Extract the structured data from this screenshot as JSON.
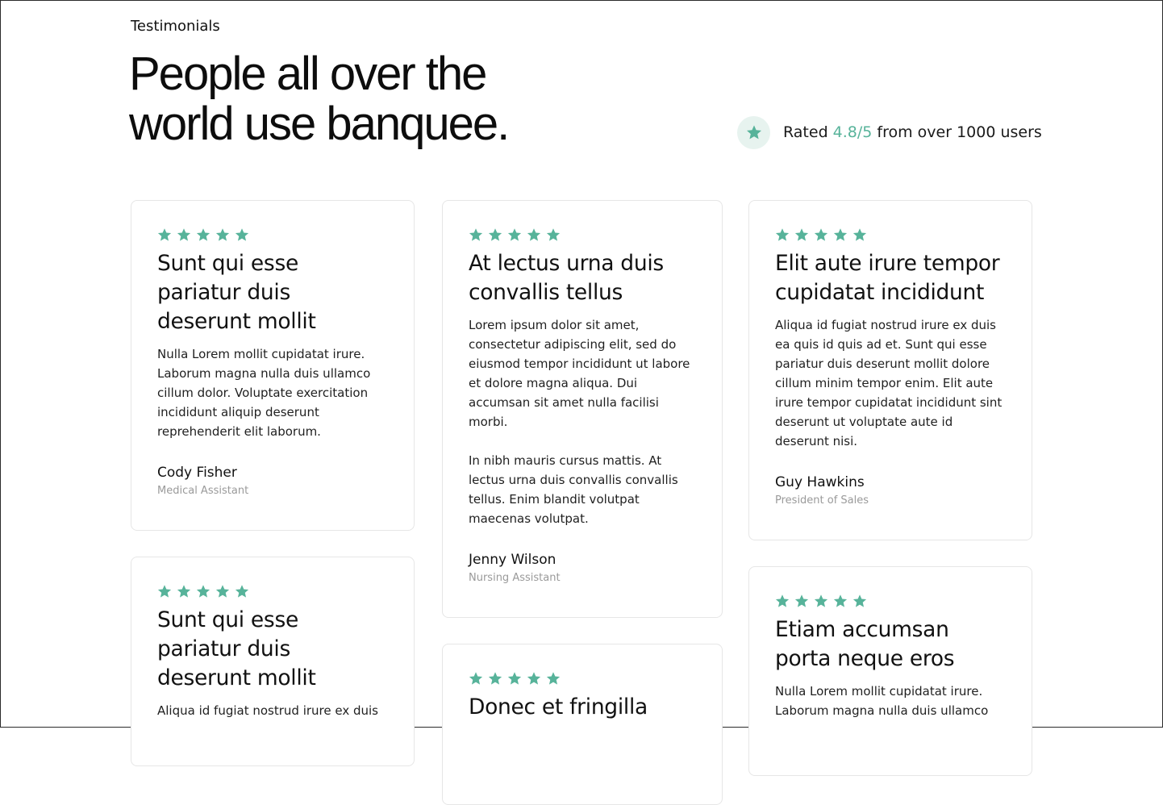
{
  "section": {
    "eyebrow": "Testimonials",
    "headline_line1": "People all over the",
    "headline_line2": "world use banquee."
  },
  "rating": {
    "prefix": "Rated ",
    "value": "4.8/5",
    "suffix": " from over 1000 users",
    "icon": "star-icon"
  },
  "colors": {
    "accent": "#57b39a",
    "badge_bg": "#e7f3ef",
    "card_border": "#e6e6e6",
    "muted_text": "#9a9a9a"
  },
  "testimonials": [
    {
      "stars": 5,
      "title": "Sunt qui esse pariatur duis deserunt mollit",
      "paragraphs": [
        "Nulla Lorem mollit cupidatat irure. Laborum magna nulla duis ullamco cillum dolor. Voluptate exercitation incididunt aliquip deserunt reprehenderit elit laborum."
      ],
      "name": "Cody Fisher",
      "role": "Medical Assistant"
    },
    {
      "stars": 5,
      "title": "At lectus urna duis convallis tellus",
      "paragraphs": [
        "Lorem ipsum dolor sit amet, consectetur adipiscing elit, sed do eiusmod tempor incididunt ut labore et dolore magna aliqua. Dui accumsan sit amet nulla facilisi morbi.",
        "In nibh mauris cursus mattis. At lectus urna duis convallis convallis tellus. Enim blandit volutpat maecenas volutpat."
      ],
      "name": "Jenny Wilson",
      "role": "Nursing Assistant"
    },
    {
      "stars": 5,
      "title": "Elit aute irure tempor cupidatat incididunt",
      "paragraphs": [
        "Aliqua id fugiat nostrud irure ex duis ea quis id quis ad et. Sunt qui esse pariatur duis deserunt mollit dolore cillum minim tempor enim. Elit aute irure tempor cupidatat incididunt sint deserunt ut voluptate aute id deserunt nisi."
      ],
      "name": "Guy Hawkins",
      "role": "President of Sales"
    },
    {
      "stars": 5,
      "title": "Sunt qui esse pariatur duis deserunt mollit",
      "paragraphs": [
        "Aliqua id fugiat nostrud irure ex duis"
      ],
      "name": "",
      "role": ""
    },
    {
      "stars": 5,
      "title": "Donec et fringilla",
      "paragraphs": [],
      "name": "",
      "role": ""
    },
    {
      "stars": 5,
      "title": "Etiam accumsan porta neque eros",
      "paragraphs": [
        "Nulla Lorem mollit cupidatat irure. Laborum magna nulla duis ullamco"
      ],
      "name": "",
      "role": ""
    }
  ]
}
